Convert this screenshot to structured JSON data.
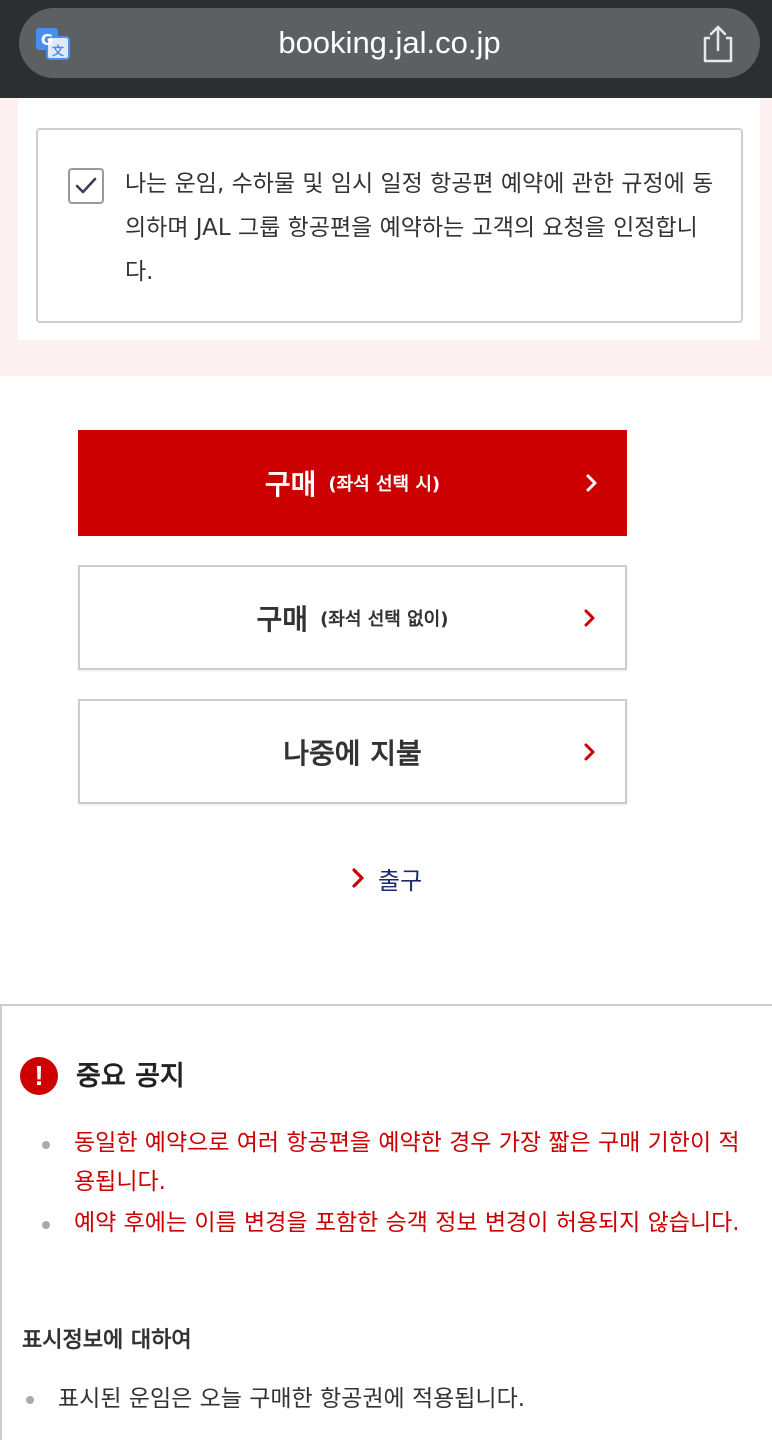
{
  "browser": {
    "url": "booking.jal.co.jp",
    "translate_icon": "translate-icon",
    "share_icon": "share-icon"
  },
  "consent": {
    "checked": true,
    "text": "나는 운임, 수하물 및 임시 일정 항공편 예약에 관한 규정에 동의하며 JAL 그룹 항공편을 예약하는 고객의 요청을 인정합니다."
  },
  "buttons": {
    "purchase_with_seat": {
      "main": "구매",
      "sub": "(좌석 선택 시)"
    },
    "purchase_without_seat": {
      "main": "구매",
      "sub": "(좌석 선택 없이)"
    },
    "pay_later": {
      "main": "나중에 지불"
    }
  },
  "exit": {
    "label": "출구"
  },
  "notice": {
    "title": "중요 공지",
    "items": [
      "동일한 예약으로 여러 항공편을 예약한 경우 가장 짧은 구매 기한이 적용됩니다.",
      "예약 후에는 이름 변경을 포함한 승객 정보 변경이 허용되지 않습니다."
    ]
  },
  "display_info": {
    "title": "표시정보에 대하여",
    "items": [
      "표시된 운임은 오늘 구매한 항공권에 적용됩니다."
    ]
  },
  "colors": {
    "accent": "#cc0000",
    "link": "#1a2a6e",
    "consent_bg": "#fdf1f1",
    "browser_bar": "#2c2f31"
  }
}
